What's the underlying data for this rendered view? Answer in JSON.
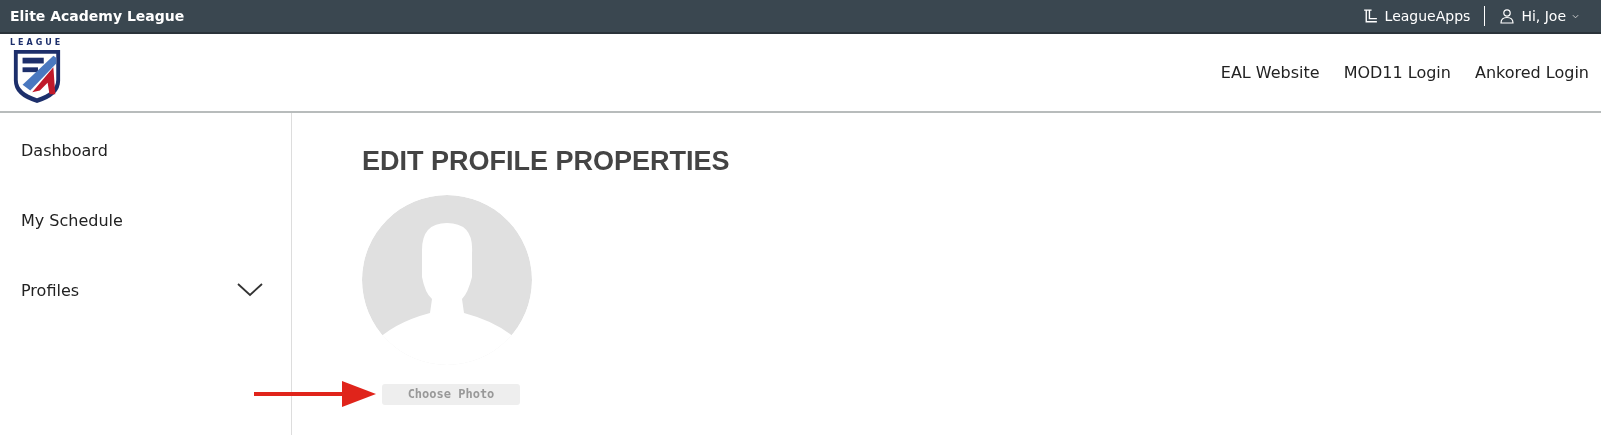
{
  "top_bar": {
    "title": "Elite Academy League",
    "brand": "LeagueApps",
    "user": "Hi, Joe"
  },
  "header": {
    "logo_text": "LEAGUE",
    "links": [
      "EAL Website",
      "MOD11 Login",
      "Ankored Login"
    ]
  },
  "sidebar": {
    "items": [
      {
        "label": "Dashboard",
        "kind": "link"
      },
      {
        "label": "My Schedule",
        "kind": "link"
      },
      {
        "label": "Profiles",
        "kind": "group",
        "expanded": false
      }
    ]
  },
  "main": {
    "heading": "EDIT PROFILE PROPERTIES",
    "choose_photo": "Choose Photo"
  }
}
